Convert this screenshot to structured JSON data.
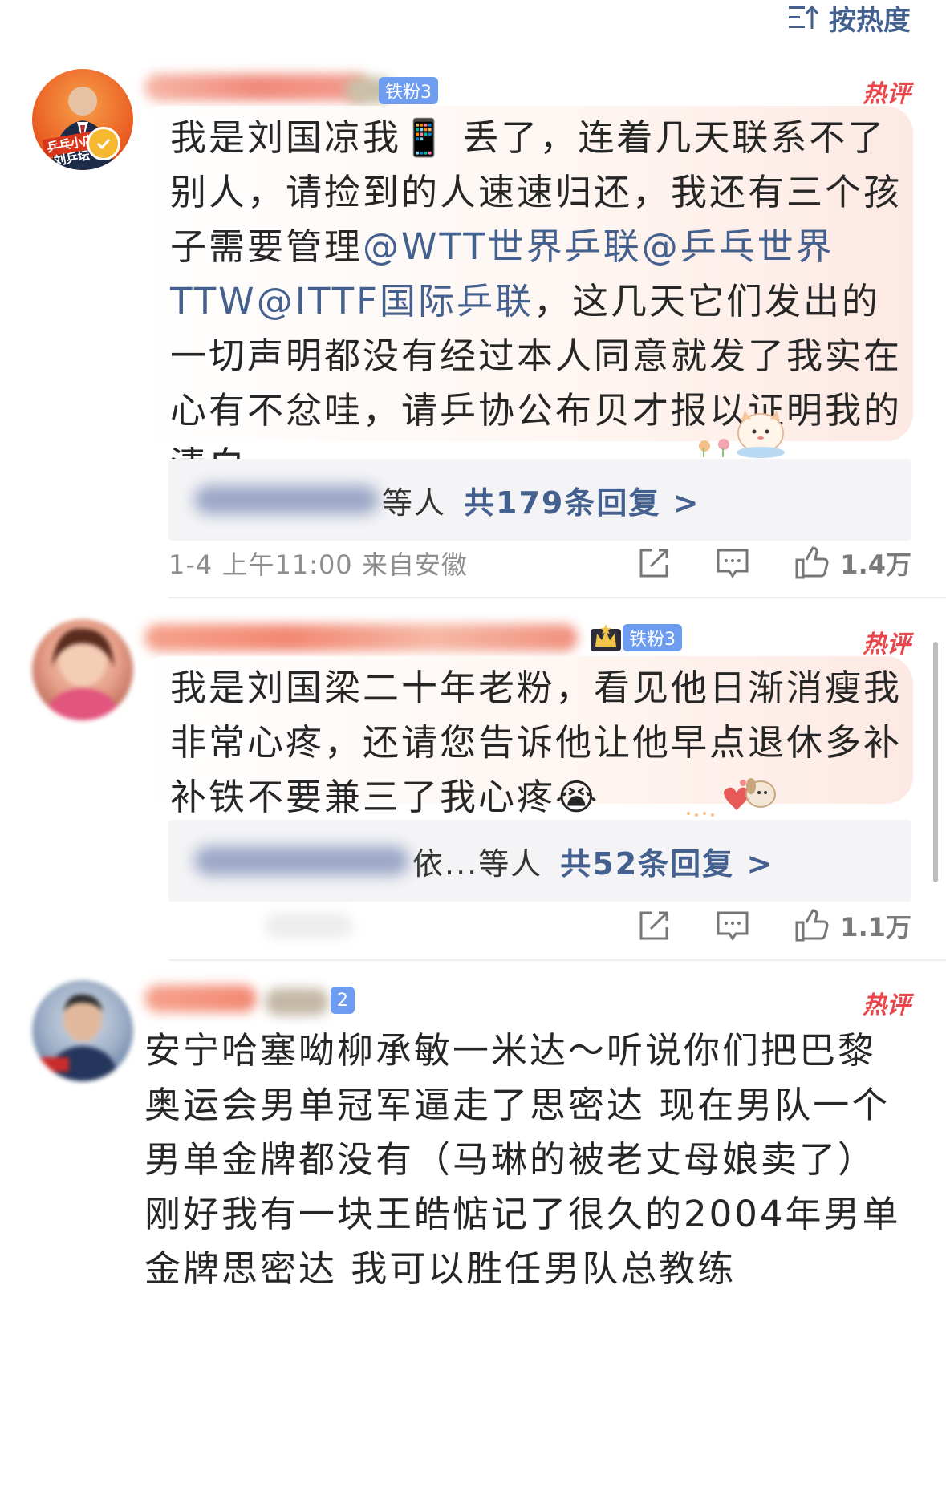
{
  "sort": {
    "label": "按热度",
    "icon": "sort-icon"
  },
  "comments": [
    {
      "fan_badge": "铁粉3",
      "hot_tag": "热评",
      "avatar_caption": "乒乓小店\n刘乒坛",
      "text_parts": [
        {
          "t": "我是刘国凉我",
          "m": false
        },
        {
          "t": "📱",
          "m": false
        },
        {
          "t": " 丢了，连着几天联系不了别人，请捡到的人速速归还，我还有三个孩子需要管理",
          "m": false
        },
        {
          "t": "@WTT世界乒联",
          "m": true
        },
        {
          "t": "@乒乓世界TTW",
          "m": true
        },
        {
          "t": "@ITTF国际乒联",
          "m": true
        },
        {
          "t": "，这几天它们发出的一切声明都没有经过本人同意就发了我实在心有不忿哇，请乒协公布贝才报以证明我的清白",
          "m": false
        }
      ],
      "reply_tail": "等人",
      "reply_link": "共179条回复 >",
      "meta": "1-4 上午11:00 来自安徽",
      "likes": "1.4万"
    },
    {
      "fan_badge": "铁粉3",
      "hot_tag": "热评",
      "text_parts": [
        {
          "t": "我是刘国梁二十年老粉，看见他日渐消瘦我非常心疼，还请您告诉他让他早点退休多补补铁不要兼三了我心疼",
          "m": false
        },
        {
          "t": "😭",
          "m": false
        }
      ],
      "reply_tail": "依...等人",
      "reply_link": "共52条回复 >",
      "meta": "",
      "likes": "1.1万"
    },
    {
      "fan_badge": "2",
      "hot_tag": "热评",
      "text_parts": [
        {
          "t": "安宁哈塞呦柳承敏一米达～听说你们把巴黎奥运会男单冠军逼走了思密达 现在男队一个男单金牌都没有（马琳的被老丈母娘卖了）刚好我有一块王皓惦记了很久的2004年男单金牌思密达 我可以胜任男队总教练",
          "m": false
        }
      ]
    }
  ],
  "icons": {
    "share": "share-icon",
    "comment": "comment-icon",
    "like": "thumbs-up-icon"
  },
  "colors": {
    "link": "#44608f",
    "hot": "#e8474c",
    "badge": "#6d9cf0"
  }
}
